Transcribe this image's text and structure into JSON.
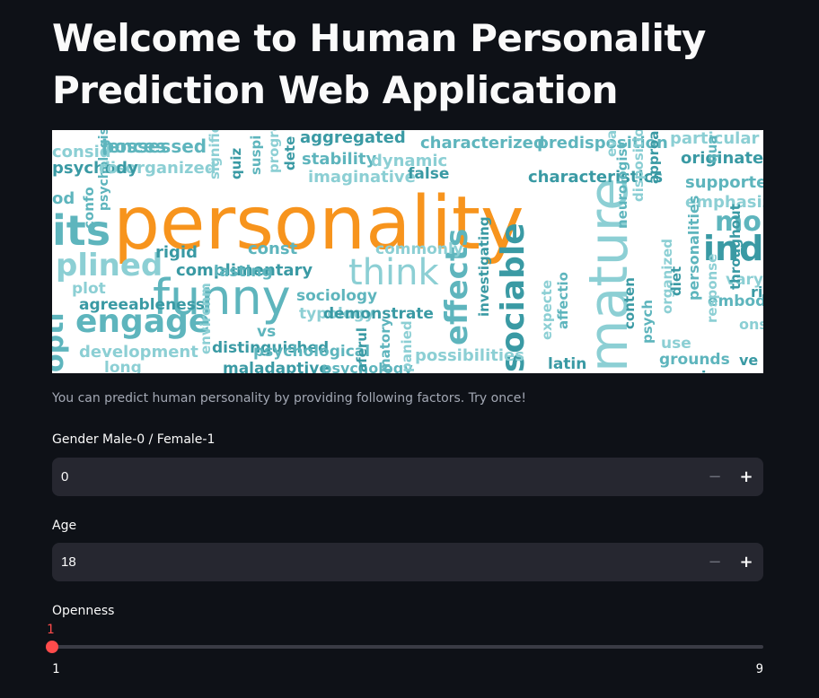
{
  "page": {
    "title": "Welcome to Human Personality Prediction Web Application",
    "description": "You can predict human personality by providing following factors. Try once!"
  },
  "banner": {
    "word_cloud": {
      "primary_words": [
        "personality",
        "funny",
        "mature",
        "sociable",
        "effects",
        "think",
        "engage",
        "plined",
        "its",
        "inde",
        "mo"
      ],
      "secondary_words": [
        "possessed",
        "disorganized",
        "aggregated",
        "stability",
        "imaginative",
        "false",
        "characterized",
        "dynamic",
        "characteristics",
        "predisposition",
        "particular",
        "originates",
        "supported",
        "emphasiz",
        "rigid",
        "const",
        "commonly",
        "complimentary",
        "lasting",
        "plot",
        "agreeableness",
        "sociology",
        "typology",
        "demonstrate",
        "vs",
        "development",
        "distinguished",
        "psychological",
        "long",
        "maladaptive",
        "psychology",
        "possibilities",
        "latin",
        "grounds",
        "use",
        "environments",
        "embodying",
        "vary",
        "conten",
        "psych",
        "organized",
        "diet",
        "personalities",
        "response",
        "throughout",
        "neurologist",
        "dispositional",
        "approaches",
        "affectio",
        "expecte",
        "investigating",
        "psychologists",
        "significantly",
        "quiz",
        "suspi",
        "progre",
        "dete",
        "confo",
        "consid",
        "psychody",
        "od",
        "ons",
        "ve",
        "qua",
        "evalu",
        "one",
        "opti",
        "environm",
        "aferul",
        "matory",
        "panied",
        "rience",
        "iences",
        "ro"
      ]
    },
    "colors": {
      "orange": "#f7941d",
      "teal": "#5eb5bd",
      "teal_light": "#8ccfd4",
      "teal_dark": "#3a9aa4"
    }
  },
  "fields": {
    "gender": {
      "label": "Gender Male-0 / Female-1",
      "value": "0",
      "minus": "−",
      "plus": "+"
    },
    "age": {
      "label": "Age",
      "value": "18",
      "minus": "−",
      "plus": "+"
    },
    "openness": {
      "label": "Openness",
      "value": "1",
      "fraction": 0.0,
      "min": "1",
      "max": "9"
    }
  },
  "colors": {
    "background": "#0e1117",
    "input_bg": "#262730",
    "accent": "#ff4b4b",
    "muted_text": "#a3a8b4"
  }
}
